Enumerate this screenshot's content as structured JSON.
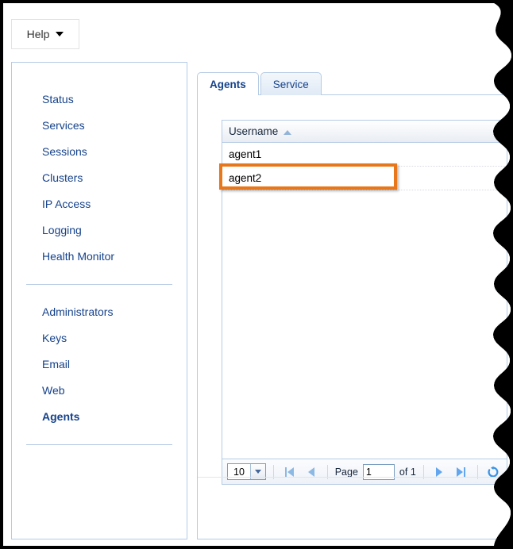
{
  "window": {
    "help_button": {
      "label": "Help",
      "icon": "caret-down-icon"
    }
  },
  "sidebar": {
    "group1": [
      {
        "label": "Status",
        "active": false
      },
      {
        "label": "Services",
        "active": false
      },
      {
        "label": "Sessions",
        "active": false
      },
      {
        "label": "Clusters",
        "active": false
      },
      {
        "label": "IP Access",
        "active": false
      },
      {
        "label": "Logging",
        "active": false
      },
      {
        "label": "Health Monitor",
        "active": false
      }
    ],
    "group2": [
      {
        "label": "Administrators",
        "active": false
      },
      {
        "label": "Keys",
        "active": false
      },
      {
        "label": "Email",
        "active": false
      },
      {
        "label": "Web",
        "active": false
      },
      {
        "label": "Agents",
        "active": true
      }
    ]
  },
  "main": {
    "tabs": [
      {
        "label": "Agents",
        "active": true
      },
      {
        "label": "Service",
        "active": false
      }
    ],
    "grid": {
      "columns": [
        {
          "label": "Username",
          "sort": "asc",
          "sort_icon": "sort-ascending-icon"
        }
      ],
      "rows": [
        {
          "username": "agent1",
          "highlighted": false
        },
        {
          "username": "agent2",
          "highlighted": true
        }
      ]
    },
    "pager": {
      "page_size": "10",
      "page_size_icon": "chevron-down-icon",
      "first_icon": "first-page-icon",
      "prev_icon": "previous-page-icon",
      "page_label": "Page",
      "page_value": "1",
      "of_label": "of 1",
      "next_icon": "next-page-icon",
      "last_icon": "last-page-icon",
      "refresh_icon": "refresh-icon"
    }
  },
  "colors": {
    "accent_blue": "#15428b",
    "border_blue": "#b5cbe4",
    "highlight_orange": "#e8761b",
    "nav_arrow_active": "#61a6ee",
    "nav_arrow_disabled": "#8cb8e4"
  }
}
